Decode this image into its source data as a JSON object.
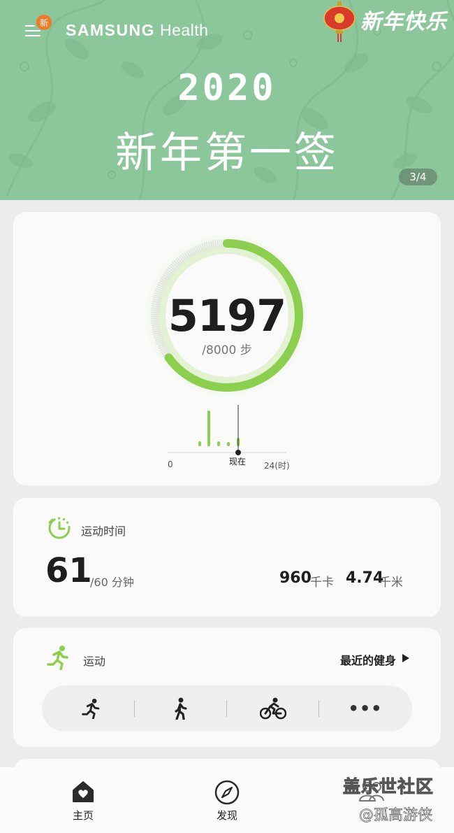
{
  "banner": {
    "new_badge": "新",
    "brand_part1": "SAMSUNG",
    "brand_part2": "Health",
    "greeting": "新年快乐",
    "year": "2020",
    "headline": "新年第一签",
    "page_indicator": "3/4",
    "colors": {
      "background": "#8bc79a"
    }
  },
  "steps": {
    "value": "5197",
    "target_label": "/8000 步",
    "progress": 0.65,
    "hourly_axis": {
      "start": "0",
      "end": "24(时)",
      "now_label": "现在"
    },
    "colors": {
      "progress": "#8ccf4f",
      "track": "#e2e2e2"
    }
  },
  "active_time": {
    "icon": "timer-icon",
    "title": "运动时间",
    "value": "61",
    "goal": "/60 分钟",
    "calories_value": "960",
    "calories_unit": "千卡",
    "distance_value": "4.74",
    "distance_unit": "千米"
  },
  "workout": {
    "icon": "runner-icon",
    "title": "运动",
    "recent_label": "最近的健身",
    "quick_start": [
      "run-icon",
      "walk-icon",
      "bike-icon",
      "more-icon"
    ],
    "more_label": "•••"
  },
  "bottom_nav": {
    "items": [
      {
        "label": "主页",
        "icon": "home-heart-icon"
      },
      {
        "label": "发现",
        "icon": "compass-icon"
      }
    ]
  },
  "watermark": {
    "line1": "盖乐世社区",
    "line2": "@孤高游侠"
  }
}
